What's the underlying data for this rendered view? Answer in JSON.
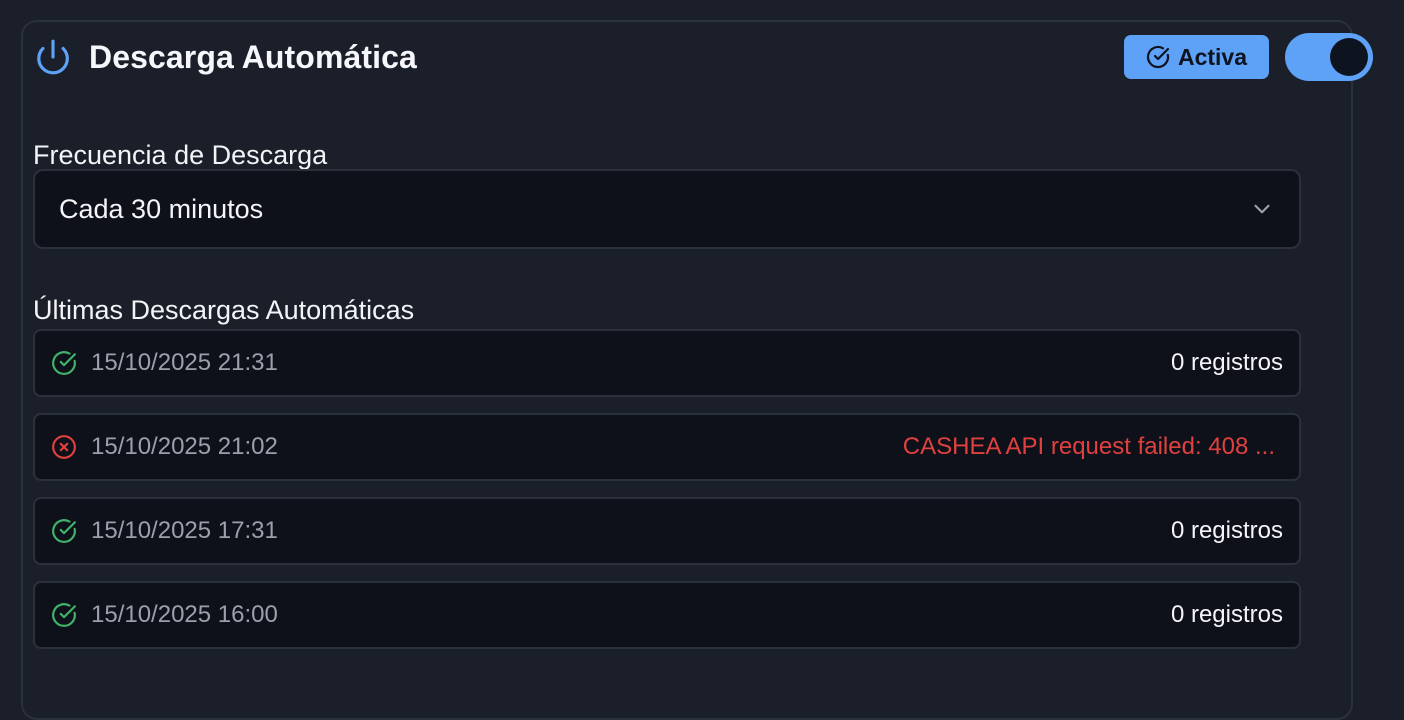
{
  "card": {
    "title": "Descarga Automática",
    "status_badge": "Activa",
    "toggle_on": true
  },
  "frequency": {
    "label": "Frecuencia de Descarga",
    "selected": "Cada 30 minutos"
  },
  "history": {
    "label": "Últimas Descargas Automáticas",
    "items": [
      {
        "status": "success",
        "timestamp": "15/10/2025 21:31",
        "result": "0 registros"
      },
      {
        "status": "error",
        "timestamp": "15/10/2025 21:02",
        "result": "CASHEA API request failed: 408 ..."
      },
      {
        "status": "success",
        "timestamp": "15/10/2025 17:31",
        "result": "0 registros"
      },
      {
        "status": "success",
        "timestamp": "15/10/2025 16:00",
        "result": "0 registros"
      }
    ]
  },
  "colors": {
    "accent": "#5ea2f7",
    "success": "#3fb46a",
    "error": "#e0413e",
    "background": "#1b1f29",
    "surface": "#0e111a"
  },
  "icons": {
    "title": "power-icon",
    "badge": "check-circle-icon",
    "select": "chevron-down-icon",
    "success": "check-circle-icon",
    "error": "x-circle-icon"
  }
}
